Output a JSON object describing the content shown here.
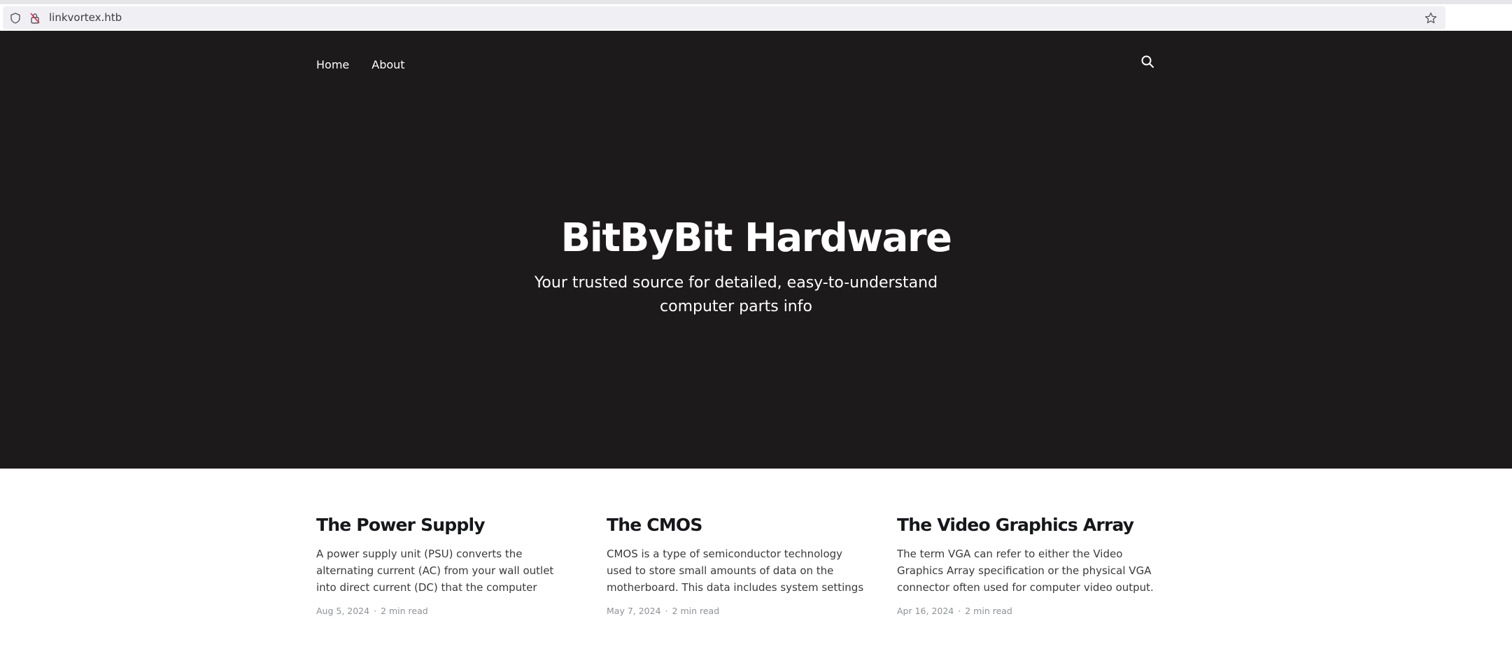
{
  "browser": {
    "url": "linkvortex.htb",
    "icons": [
      "shield-icon",
      "insecure-lock-icon",
      "bookmark-star-icon"
    ]
  },
  "nav": {
    "items": [
      {
        "label": "Home"
      },
      {
        "label": "About"
      }
    ],
    "search_icon": "search-icon"
  },
  "hero": {
    "title": "BitByBit Hardware",
    "subtitle": "Your trusted source for detailed, easy-to-understand computer parts info",
    "background_color": "#1d1a1b"
  },
  "posts": [
    {
      "title": "The Power Supply",
      "excerpt": "A power supply unit (PSU) converts the alternating current (AC) from your wall outlet into direct current (DC) that the computer components require. It…",
      "date": "Aug 5, 2024",
      "read_time": "2 min read",
      "separator": "·"
    },
    {
      "title": "The CMOS",
      "excerpt": "CMOS is a type of semiconductor technology used to store small amounts of data on the motherboard. This data includes system settings and…",
      "date": "May 7, 2024",
      "read_time": "2 min read",
      "separator": "·"
    },
    {
      "title": "The Video Graphics Array",
      "excerpt": "The term VGA can refer to either the Video Graphics Array specification or the physical VGA connector often used for computer video output. Below, I'll…",
      "date": "Apr 16, 2024",
      "read_time": "2 min read",
      "separator": "·"
    }
  ]
}
